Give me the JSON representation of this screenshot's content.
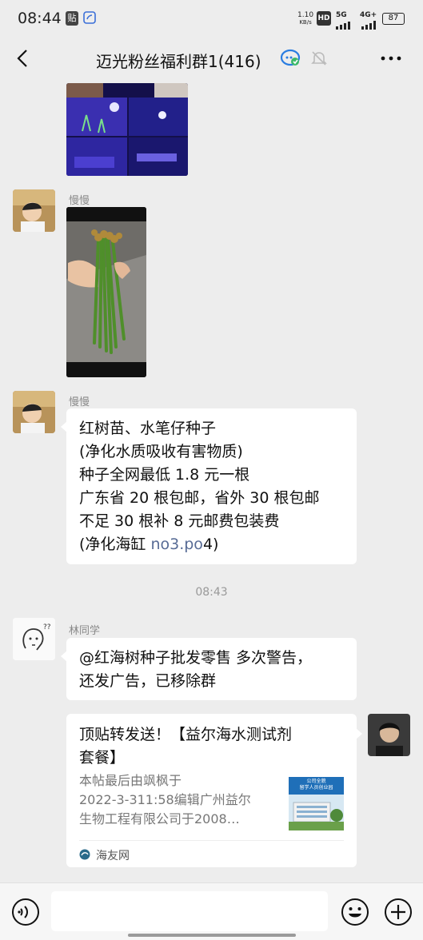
{
  "status_bar": {
    "time": "08:44",
    "badge_text": "贴",
    "speed_value": "1.10",
    "speed_unit": "KB/s",
    "hd_label": "HD",
    "net_5g": "5G",
    "net_4g": "4G+",
    "battery": "87"
  },
  "header": {
    "title": "迈光粉丝福利群1(416)"
  },
  "messages": {
    "m2": {
      "sender": "慢慢"
    },
    "m3": {
      "sender": "慢慢",
      "line1": "红树苗、水笔仔种子",
      "line2": "(净化水质吸收有害物质)",
      "line3": "种子全网最低 1.8 元一根",
      "line4": "广东省 20 根包邮，省外 30 根包邮",
      "line5": "不足 30 根补 8 元邮费包装费",
      "line6_prefix": "(净化海缸 ",
      "line6_link": "no3.po",
      "line6_suffix": "4)"
    },
    "timestamp": "08:43",
    "m4": {
      "sender": "林同学",
      "line1": "@红海树种子批发零售  多次警告，",
      "line2": "还发广告，已移除群"
    },
    "m5": {
      "title_line1": "顶贴转发送！【益尔海水测试剂",
      "title_line2": "套餐】",
      "desc_line1": "本帖最后由飒枫于",
      "desc_line2": "2022-3-311:58编辑广州益尔",
      "desc_line3": "生物工程有限公司于2008…",
      "thumb_line1": "公司全貌",
      "thumb_line2": "留学人员创业园",
      "source": "海友网"
    }
  },
  "colors": {
    "background": "#ededed",
    "bubble": "#ffffff",
    "link": "#576b95",
    "meta_text": "#888888"
  }
}
